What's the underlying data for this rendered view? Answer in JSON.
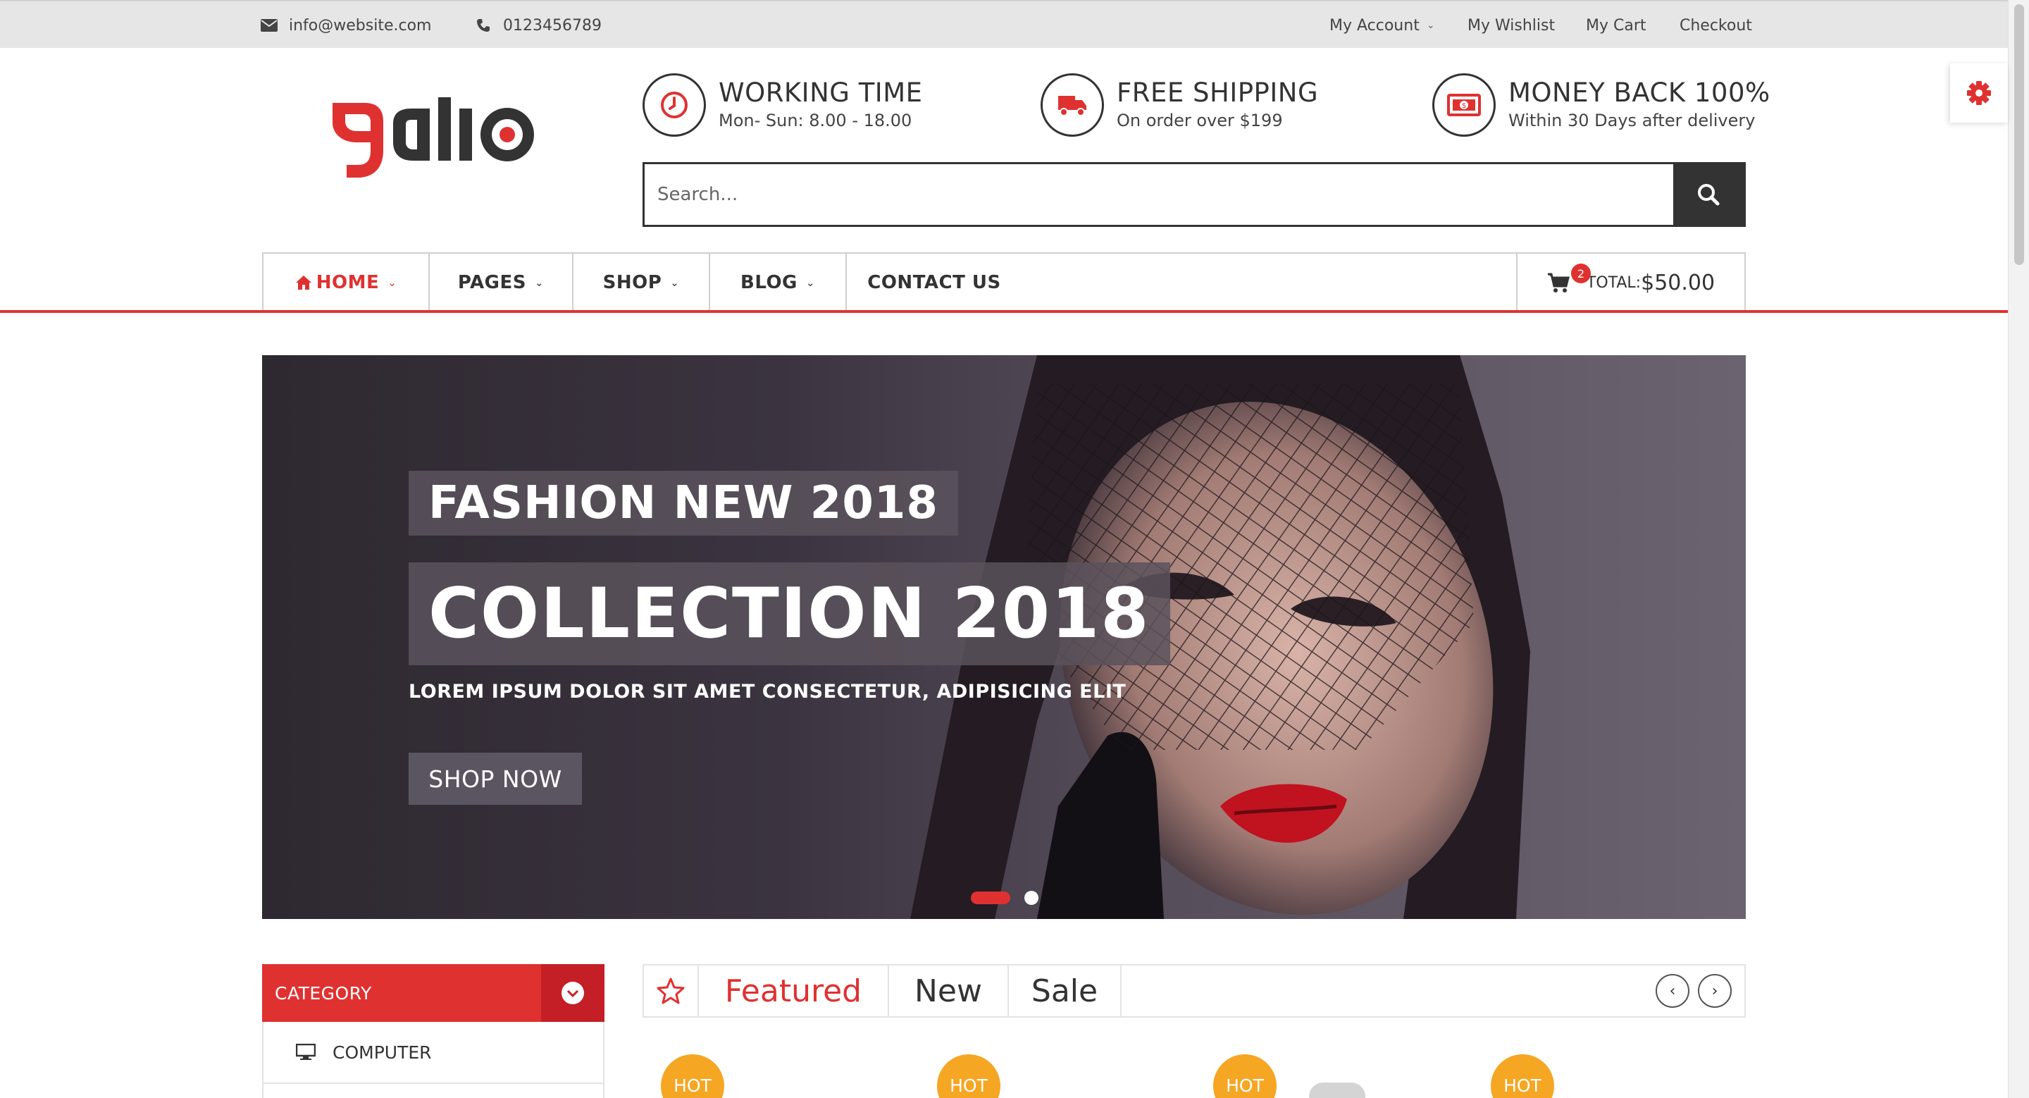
{
  "topbar": {
    "email": "info@website.com",
    "phone": "0123456789",
    "links": [
      "My Account",
      "My Wishlist",
      "My Cart",
      "Checkout"
    ]
  },
  "header": {
    "logo_text": "galio",
    "features": [
      {
        "title": "WORKING TIME",
        "sub": "Mon- Sun: 8.00 - 18.00",
        "icon": "clock-icon"
      },
      {
        "title": "FREE SHIPPING",
        "sub": "On order over $199",
        "icon": "truck-icon"
      },
      {
        "title": "MONEY BACK 100%",
        "sub": "Within 30 Days after delivery",
        "icon": "money-icon"
      }
    ],
    "search_placeholder": "Search..."
  },
  "nav": {
    "items": [
      "HOME",
      "PAGES",
      "SHOP",
      "BLOG",
      "CONTACT US"
    ],
    "cart_count": "2",
    "total_label": "TOTAL:",
    "total_value": "$50.00"
  },
  "hero": {
    "line1": "FASHION NEW 2018",
    "line2": "COLLECTION 2018",
    "tagline": "LOREM IPSUM DOLOR SIT AMET CONSECTETUR, ADIPISICING ELIT",
    "button": "SHOP NOW",
    "slides": 2,
    "active_slide": 1
  },
  "category": {
    "title": "CATEGORY",
    "items": [
      "COMPUTER"
    ]
  },
  "product_tabs": {
    "tabs": [
      "Featured",
      "New",
      "Sale"
    ],
    "active": "Featured"
  },
  "badges": [
    "HOT",
    "HOT",
    "HOT",
    "HOT"
  ],
  "colors": {
    "accent": "#e03131",
    "dark": "#333333",
    "badge": "#f5a623"
  }
}
